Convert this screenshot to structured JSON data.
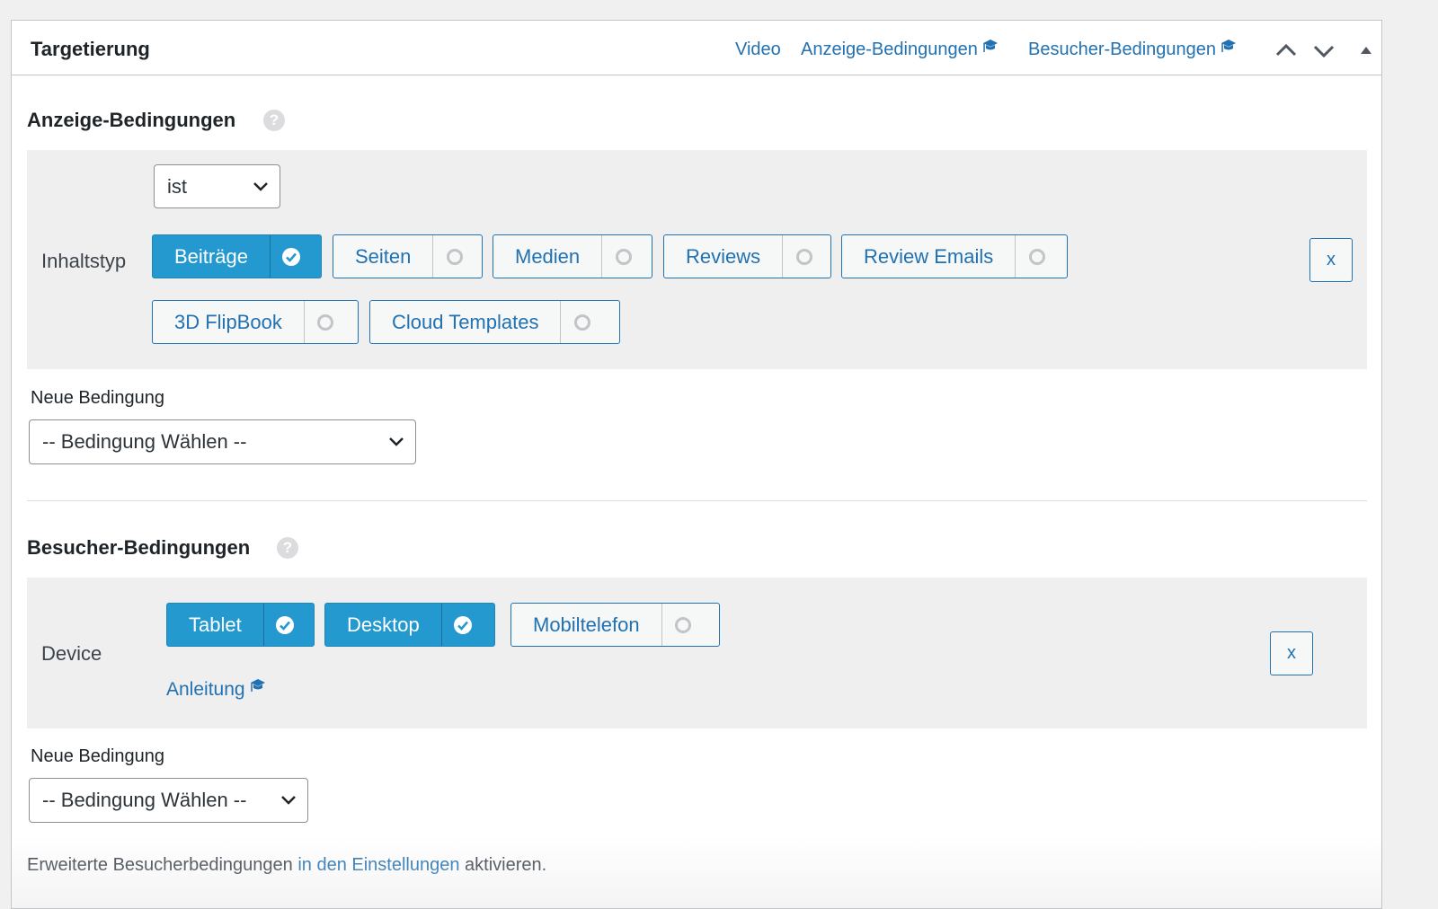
{
  "metabox": {
    "title": "Targetierung",
    "header_links": [
      {
        "label": "Video"
      },
      {
        "label": "Anzeige-Bedingungen"
      },
      {
        "label": "Besucher-Bedingungen"
      }
    ]
  },
  "display_conditions": {
    "title": "Anzeige-Bedingungen",
    "help": "?",
    "operator": "ist",
    "row_label": "Inhaltstyp",
    "options": [
      {
        "label": "Beiträge",
        "checked": true
      },
      {
        "label": "Seiten",
        "checked": false
      },
      {
        "label": "Medien",
        "checked": false
      },
      {
        "label": "Reviews",
        "checked": false
      },
      {
        "label": "Review Emails",
        "checked": false
      },
      {
        "label": "3D FlipBook",
        "checked": false
      },
      {
        "label": "Cloud Templates",
        "checked": false
      }
    ],
    "remove_label": "x",
    "new_condition_label": "Neue Bedingung",
    "new_condition_select": "-- Bedingung Wählen --"
  },
  "visitor_conditions": {
    "title": "Besucher-Bedingungen",
    "help": "?",
    "row_label": "Device",
    "options": [
      {
        "label": "Tablet",
        "checked": true
      },
      {
        "label": "Desktop",
        "checked": true
      },
      {
        "label": "Mobiltelefon",
        "checked": false
      }
    ],
    "manual_link": "Anleitung",
    "remove_label": "x",
    "new_condition_label": "Neue Bedingung",
    "new_condition_select": "-- Bedingung Wählen --"
  },
  "footer": {
    "text_before": "Erweiterte Besucherbedingungen",
    "link": "in den Einstellungen",
    "text_after": "aktivieren."
  },
  "colors": {
    "accent": "#2271b1",
    "active_chip": "#2399cf",
    "panel_bg": "#efefef"
  }
}
